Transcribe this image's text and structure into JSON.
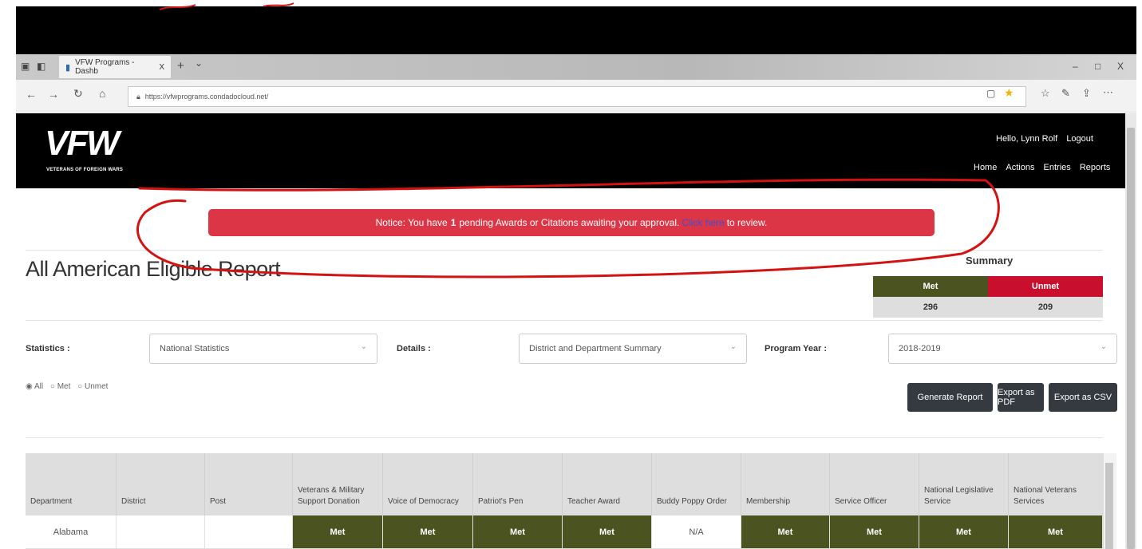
{
  "browser": {
    "tab_title": "VFW Programs - Dashb",
    "tab_close": "X",
    "new_tab": "+",
    "tab_menu": "⌄",
    "url": "https://vfwprograms.condadocloud.net/",
    "window_controls": [
      "–",
      "□",
      "X"
    ]
  },
  "site": {
    "logo": "VFW",
    "logo_sub": "VETERANS OF FOREIGN WARS",
    "greeting": "Hello, Lynn Rolf",
    "logout": "Logout",
    "nav": [
      "Home",
      "Actions",
      "Entries",
      "Reports"
    ]
  },
  "notice": {
    "prefix": "Notice: You have",
    "count": "1",
    "middle": "pending Awards or Citations awaiting your approval.",
    "link": "Click here",
    "suffix": "to review."
  },
  "page": {
    "title": "All American Eligible Report"
  },
  "summary": {
    "title": "Summary",
    "met_label": "Met",
    "unmet_label": "Unmet",
    "met_value": "296",
    "unmet_value": "209",
    "colors": {
      "met": "#4b5320",
      "unmet": "#c8102e"
    }
  },
  "filters": {
    "statistics_label": "Statistics :",
    "statistics_value": "National Statistics",
    "details_label": "Details :",
    "details_value": "District and Department Summary",
    "year_label": "Program Year :",
    "year_value": "2018-2019",
    "radio": {
      "all": "All",
      "met": "Met",
      "unmet": "Unmet",
      "selected": "All"
    }
  },
  "buttons": {
    "generate": "Generate Report",
    "pdf": "Export as PDF",
    "csv": "Export as CSV"
  },
  "table": {
    "headers": [
      "Department",
      "District",
      "Post",
      "Veterans & Military Support Donation",
      "Voice of Democracy",
      "Patriot's Pen",
      "Teacher Award",
      "Buddy Poppy Order",
      "Membership",
      "Service Officer",
      "National Legislative Service",
      "National Veterans Services"
    ],
    "rows": [
      [
        "Alabama",
        "",
        "",
        "Met",
        "Met",
        "Met",
        "Met",
        "N/A",
        "Met",
        "Met",
        "Met",
        "Met"
      ]
    ]
  }
}
